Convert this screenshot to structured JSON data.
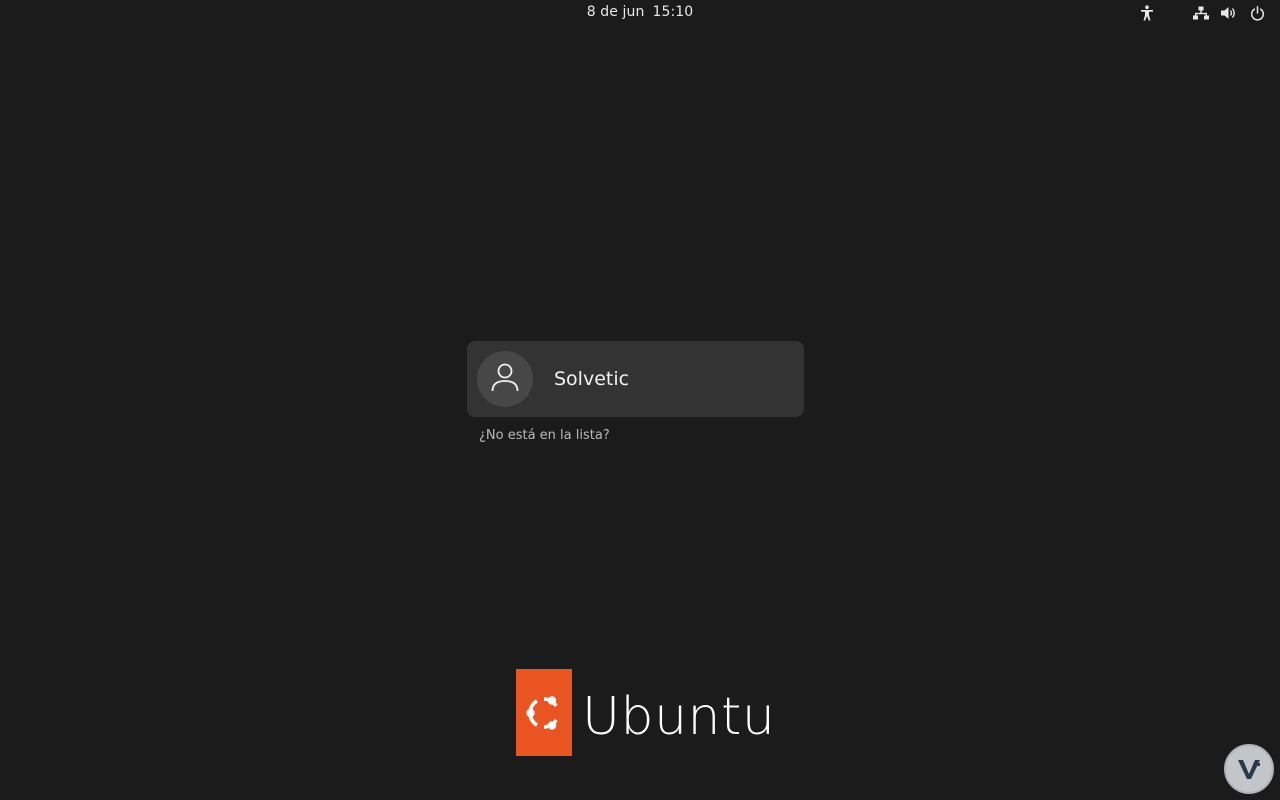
{
  "topbar": {
    "date": "8 de jun",
    "time": "15:10",
    "icons": [
      "accessibility-icon",
      "network-icon",
      "volume-icon",
      "power-icon"
    ]
  },
  "login": {
    "user_name": "Solvetic",
    "not_listed_label": "¿No está en la lista?"
  },
  "branding": {
    "wordmark": "Ubuntu",
    "accent_color": "#e95420"
  },
  "watermark": {
    "icon": "solvetic-watermark-icon"
  }
}
